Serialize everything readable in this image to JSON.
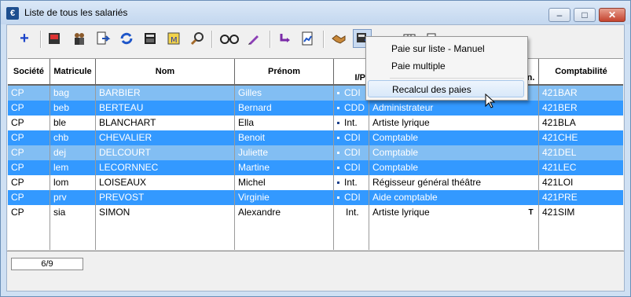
{
  "window": {
    "title": "Liste de tous les salariés",
    "app_icon_glyph": "€",
    "buttons": {
      "minimize": "–",
      "maximize": "□",
      "close": "✕"
    }
  },
  "toolbar": {
    "icons": [
      "add-icon",
      "print-icon",
      "people-icon",
      "export-icon",
      "refresh-icon",
      "calculator-icon",
      "badge-icon",
      "search-icon",
      "glasses-icon",
      "pen-icon",
      "transfer-icon",
      "report-icon",
      "handshake-icon",
      "pay-icon",
      "text-icon",
      "table-icon",
      "document-icon"
    ],
    "text_icon_label": "TEXT"
  },
  "table": {
    "headers": [
      "Société",
      "Matricule",
      "Nom",
      "Prénom",
      "I/P",
      "",
      "n.",
      "Comptabilité"
    ],
    "rows": [
      {
        "societe": "CP",
        "matricule": "bag",
        "nom": "BARBIER",
        "prenom": "Gilles",
        "ip": "CDI",
        "emploi": "",
        "flag": "",
        "compta": "421BAR",
        "state": "light"
      },
      {
        "societe": "CP",
        "matricule": "beb",
        "nom": "BERTEAU",
        "prenom": "Bernard",
        "ip": "CDD",
        "emploi": "Administrateur",
        "flag": "",
        "compta": "421BER",
        "state": "sel"
      },
      {
        "societe": "CP",
        "matricule": "ble",
        "nom": "BLANCHART",
        "prenom": "Ella",
        "ip": "Int.",
        "emploi": "Artiste lyrique",
        "flag": "",
        "compta": "421BLA",
        "state": ""
      },
      {
        "societe": "CP",
        "matricule": "chb",
        "nom": "CHEVALIER",
        "prenom": "Benoit",
        "ip": "CDI",
        "emploi": "Comptable",
        "flag": "",
        "compta": "421CHE",
        "state": "sel"
      },
      {
        "societe": "CP",
        "matricule": "dej",
        "nom": "DELCOURT",
        "prenom": "Juliette",
        "ip": "CDI",
        "emploi": "Comptable",
        "flag": "",
        "compta": "421DEL",
        "state": "light"
      },
      {
        "societe": "CP",
        "matricule": "lem",
        "nom": "LECORNNEC",
        "prenom": "Martine",
        "ip": "CDI",
        "emploi": "Comptable",
        "flag": "",
        "compta": "421LEC",
        "state": "sel"
      },
      {
        "societe": "CP",
        "matricule": "lom",
        "nom": "LOISEAUX",
        "prenom": "Michel",
        "ip": "Int.",
        "emploi": "Régisseur général théâtre",
        "flag": "",
        "compta": "421LOI",
        "state": ""
      },
      {
        "societe": "CP",
        "matricule": "prv",
        "nom": "PREVOST",
        "prenom": "Virginie",
        "ip": "CDI",
        "emploi": "Aide comptable",
        "flag": "",
        "compta": "421PRE",
        "state": "sel"
      },
      {
        "societe": "CP",
        "matricule": "sia",
        "nom": "SIMON",
        "prenom": "Alexandre",
        "ip": "Int.",
        "emploi": "Artiste lyrique",
        "flag": "T",
        "compta": "421SIM",
        "state": ""
      }
    ]
  },
  "status": {
    "counter": "6/9"
  },
  "context_menu": {
    "items": [
      "Paie sur liste - Manuel",
      "Paie multiple",
      "Recalcul des paies"
    ],
    "hovered": "Recalcul des paies"
  }
}
